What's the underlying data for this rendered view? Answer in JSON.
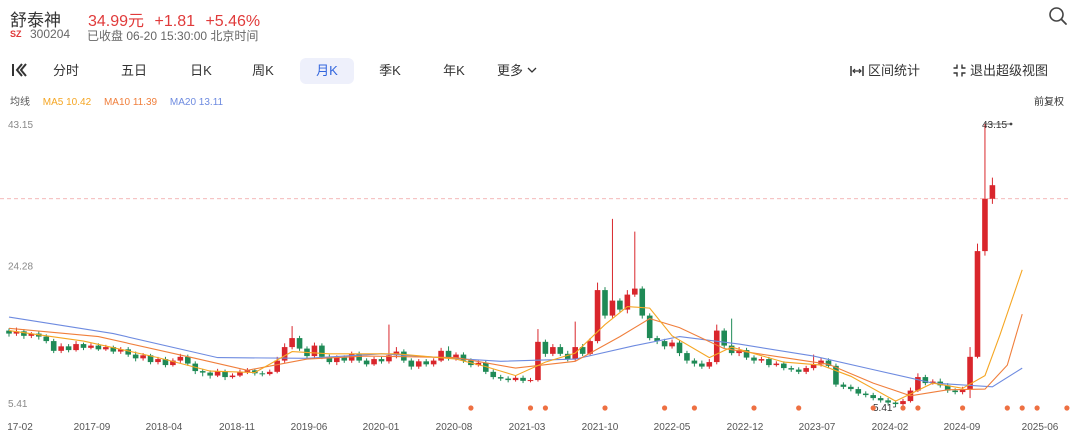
{
  "stock": {
    "name": "舒泰神",
    "price": "34.99元",
    "change": "+1.81",
    "change_pct": "+5.46%",
    "market": "SZ",
    "code": "300204",
    "status": "已收盘 06-20 15:30:00 北京时间"
  },
  "colors": {
    "up": "#d9262c",
    "down": "#1f8a56",
    "ma5": "#f5a623",
    "ma10": "#f07f3c",
    "ma20": "#6e8be0",
    "marker": "#ee7042"
  },
  "icons": {
    "search": "search-icon",
    "collapse": "collapse-icon",
    "interval": "interval-icon",
    "exit_fullscreen": "exit-fullscreen-icon",
    "chevron": "chevron-down-icon"
  },
  "toolbar": {
    "periods": [
      "分时",
      "五日",
      "日K",
      "周K",
      "月K",
      "季K",
      "年K"
    ],
    "active_period": "月K",
    "more": "更多",
    "interval_stats": "区间统计",
    "exit_super_view": "退出超级视图"
  },
  "indicators": {
    "label": "均线",
    "ma5": "MA5 10.42",
    "ma10": "MA10 11.39",
    "ma20": "MA20 13.11",
    "adjust": "前复权"
  },
  "chart_data": {
    "type": "candlestick",
    "y_ticks": [
      "43.15",
      "24.28",
      "5.41"
    ],
    "ylim": [
      5.41,
      43.15
    ],
    "x_ticks": [
      "2017-02",
      "2017-09",
      "2018-04",
      "2018-11",
      "2019-06",
      "2020-01",
      "2020-08",
      "2021-03",
      "2021-10",
      "2022-05",
      "2022-12",
      "2023-07",
      "2024-02",
      "2024-09",
      "2025-06"
    ],
    "x_tick_first_visible": "17-02",
    "max_label": "43.15",
    "min_label": "5.41",
    "reference_line": 33.18,
    "candles": [
      [
        15.6,
        15.2,
        15.9,
        14.8
      ],
      [
        15.2,
        15.5,
        16.0,
        14.9
      ],
      [
        15.5,
        14.9,
        15.8,
        14.5
      ],
      [
        14.9,
        15.2,
        15.4,
        14.6
      ],
      [
        15.2,
        14.8,
        15.6,
        14.4
      ],
      [
        14.8,
        14.2,
        15.1,
        13.9
      ],
      [
        14.2,
        12.9,
        14.5,
        12.6
      ],
      [
        12.9,
        13.5,
        13.9,
        12.6
      ],
      [
        13.5,
        13.0,
        13.8,
        12.7
      ],
      [
        13.0,
        13.8,
        14.2,
        12.8
      ],
      [
        13.8,
        13.3,
        14.0,
        13.0
      ],
      [
        13.3,
        13.6,
        13.9,
        13.1
      ],
      [
        13.6,
        13.1,
        13.9,
        12.9
      ],
      [
        13.1,
        13.4,
        13.7,
        12.9
      ],
      [
        13.4,
        12.8,
        13.6,
        12.5
      ],
      [
        12.8,
        13.1,
        13.4,
        12.5
      ],
      [
        13.1,
        12.4,
        13.4,
        12.1
      ],
      [
        12.4,
        11.9,
        12.8,
        11.5
      ],
      [
        11.9,
        12.3,
        12.6,
        11.6
      ],
      [
        12.3,
        11.4,
        12.5,
        11.1
      ],
      [
        11.4,
        11.8,
        12.1,
        11.1
      ],
      [
        11.8,
        11.0,
        12.1,
        10.7
      ],
      [
        11.0,
        11.6,
        11.9,
        10.8
      ],
      [
        11.6,
        12.1,
        12.5,
        11.3
      ],
      [
        12.1,
        11.2,
        12.4,
        10.9
      ],
      [
        11.2,
        10.2,
        11.5,
        9.8
      ],
      [
        10.2,
        10.0,
        10.5,
        9.5
      ],
      [
        10.0,
        9.6,
        10.3,
        9.2
      ],
      [
        9.6,
        10.2,
        10.5,
        9.4
      ],
      [
        10.2,
        9.4,
        10.4,
        9.0
      ],
      [
        9.4,
        9.6,
        9.9,
        9.2
      ],
      [
        9.6,
        10.1,
        10.4,
        9.4
      ],
      [
        10.1,
        10.3,
        10.6,
        9.8
      ],
      [
        10.3,
        9.9,
        10.5,
        9.6
      ],
      [
        9.9,
        9.8,
        10.2,
        9.5
      ],
      [
        9.8,
        10.1,
        10.4,
        9.6
      ],
      [
        10.1,
        11.6,
        12.1,
        9.9
      ],
      [
        11.6,
        13.4,
        13.9,
        11.3
      ],
      [
        13.4,
        14.6,
        16.2,
        13.1
      ],
      [
        14.6,
        13.2,
        14.9,
        12.9
      ],
      [
        13.2,
        12.2,
        13.5,
        11.8
      ],
      [
        12.2,
        13.6,
        14.0,
        11.9
      ],
      [
        13.6,
        12.1,
        13.9,
        11.8
      ],
      [
        12.1,
        11.4,
        12.4,
        11.1
      ],
      [
        11.4,
        12.0,
        12.3,
        11.0
      ],
      [
        12.0,
        11.6,
        12.3,
        11.3
      ],
      [
        11.6,
        12.5,
        12.8,
        11.3
      ],
      [
        12.5,
        11.6,
        12.8,
        11.3
      ],
      [
        11.6,
        11.1,
        11.9,
        10.8
      ],
      [
        11.1,
        11.8,
        12.1,
        10.9
      ],
      [
        11.8,
        11.5,
        12.1,
        11.2
      ],
      [
        11.5,
        12.3,
        16.4,
        11.2
      ],
      [
        12.3,
        12.8,
        13.4,
        11.9
      ],
      [
        12.8,
        11.6,
        13.1,
        11.3
      ],
      [
        11.6,
        10.8,
        11.9,
        10.4
      ],
      [
        10.8,
        11.5,
        11.8,
        10.5
      ],
      [
        11.5,
        11.1,
        11.8,
        10.8
      ],
      [
        11.1,
        11.6,
        11.9,
        10.8
      ],
      [
        11.6,
        12.9,
        13.3,
        11.4
      ],
      [
        12.9,
        11.9,
        13.5,
        11.6
      ],
      [
        11.9,
        12.4,
        12.7,
        11.6
      ],
      [
        12.4,
        11.6,
        12.7,
        11.3
      ],
      [
        11.6,
        11.0,
        11.9,
        10.7
      ],
      [
        11.0,
        11.3,
        11.6,
        10.8
      ],
      [
        11.3,
        10.1,
        11.6,
        9.8
      ],
      [
        10.1,
        9.4,
        10.4,
        9.1
      ],
      [
        9.4,
        9.2,
        9.7,
        8.9
      ],
      [
        9.2,
        9.0,
        9.5,
        8.7
      ],
      [
        9.0,
        9.3,
        9.6,
        8.8
      ],
      [
        9.3,
        8.9,
        9.6,
        8.6
      ],
      [
        8.9,
        9.0,
        9.3,
        8.7
      ],
      [
        9.0,
        14.1,
        15.8,
        8.8
      ],
      [
        14.1,
        12.5,
        14.4,
        12.1
      ],
      [
        12.5,
        13.4,
        13.8,
        12.2
      ],
      [
        13.4,
        12.5,
        13.8,
        12.2
      ],
      [
        12.5,
        11.8,
        12.9,
        11.5
      ],
      [
        11.8,
        13.4,
        16.8,
        11.6
      ],
      [
        13.4,
        12.5,
        13.8,
        12.2
      ],
      [
        12.5,
        14.2,
        14.6,
        12.3
      ],
      [
        14.2,
        21.0,
        22.0,
        13.9
      ],
      [
        21.0,
        17.6,
        21.4,
        17.2
      ],
      [
        17.6,
        19.6,
        30.5,
        17.3
      ],
      [
        19.6,
        18.4,
        19.9,
        18.1
      ],
      [
        18.4,
        20.4,
        21.0,
        17.9
      ],
      [
        20.4,
        21.2,
        28.8,
        20.1
      ],
      [
        21.2,
        17.6,
        21.5,
        17.2
      ],
      [
        17.6,
        14.6,
        17.9,
        14.3
      ],
      [
        14.6,
        14.2,
        14.9,
        13.8
      ],
      [
        14.2,
        13.5,
        14.5,
        13.1
      ],
      [
        13.5,
        14.0,
        14.4,
        13.2
      ],
      [
        14.0,
        12.6,
        14.3,
        12.2
      ],
      [
        12.6,
        11.6,
        12.9,
        11.2
      ],
      [
        11.6,
        11.2,
        11.9,
        10.8
      ],
      [
        11.2,
        10.8,
        11.6,
        10.5
      ],
      [
        10.8,
        11.4,
        11.8,
        10.5
      ],
      [
        11.4,
        15.6,
        16.4,
        11.1
      ],
      [
        15.6,
        13.6,
        15.9,
        13.3
      ],
      [
        13.6,
        12.6,
        17.2,
        12.3
      ],
      [
        12.6,
        13.0,
        13.4,
        12.2
      ],
      [
        13.0,
        12.0,
        13.3,
        11.7
      ],
      [
        12.0,
        11.6,
        12.3,
        11.2
      ],
      [
        11.6,
        11.8,
        12.1,
        11.3
      ],
      [
        11.8,
        11.0,
        12.1,
        10.7
      ],
      [
        11.0,
        11.2,
        11.5,
        10.8
      ],
      [
        11.2,
        10.6,
        11.5,
        10.3
      ],
      [
        10.6,
        10.4,
        10.9,
        10.1
      ],
      [
        10.4,
        10.1,
        10.7,
        9.8
      ],
      [
        10.1,
        10.6,
        10.9,
        9.8
      ],
      [
        10.6,
        11.1,
        12.4,
        10.3
      ],
      [
        11.1,
        11.6,
        12.0,
        10.8
      ],
      [
        11.6,
        10.9,
        11.9,
        10.6
      ],
      [
        10.9,
        8.4,
        11.2,
        8.1
      ],
      [
        8.4,
        8.1,
        8.7,
        7.8
      ],
      [
        8.1,
        7.8,
        8.4,
        7.5
      ],
      [
        7.8,
        7.2,
        8.1,
        6.9
      ],
      [
        7.2,
        7.0,
        7.5,
        6.7
      ],
      [
        7.0,
        6.6,
        7.3,
        6.3
      ],
      [
        6.6,
        6.3,
        6.9,
        6.0
      ],
      [
        6.3,
        6.0,
        6.6,
        5.7
      ],
      [
        6.0,
        5.8,
        6.3,
        5.41
      ],
      [
        5.8,
        6.2,
        6.5,
        5.6
      ],
      [
        6.2,
        7.6,
        8.0,
        6.0
      ],
      [
        7.6,
        9.4,
        9.9,
        7.4
      ],
      [
        9.4,
        8.6,
        9.7,
        8.3
      ],
      [
        8.6,
        8.8,
        9.1,
        8.4
      ],
      [
        8.8,
        8.3,
        9.2,
        8.0
      ],
      [
        8.3,
        7.6,
        8.6,
        7.3
      ],
      [
        7.6,
        7.4,
        7.9,
        7.1
      ],
      [
        7.4,
        7.8,
        8.1,
        7.1
      ],
      [
        7.8,
        12.1,
        13.4,
        6.6
      ],
      [
        12.1,
        26.2,
        27.2,
        11.9
      ],
      [
        26.2,
        33.18,
        43.15,
        25.6
      ],
      [
        33.18,
        34.99,
        36.0,
        32.5
      ]
    ],
    "ma5": [
      [
        0,
        15.6
      ],
      [
        10,
        14.2
      ],
      [
        20,
        12.0
      ],
      [
        27,
        10.2
      ],
      [
        33,
        10.0
      ],
      [
        38,
        12.8
      ],
      [
        43,
        12.5
      ],
      [
        52,
        12.5
      ],
      [
        60,
        11.8
      ],
      [
        64,
        10.8
      ],
      [
        68,
        9.6
      ],
      [
        72,
        11.4
      ],
      [
        76,
        12.6
      ],
      [
        80,
        16.4
      ],
      [
        83,
        18.8
      ],
      [
        86,
        18.6
      ],
      [
        89,
        14.9
      ],
      [
        94,
        12.0
      ],
      [
        97,
        13.4
      ],
      [
        104,
        11.4
      ],
      [
        109,
        11.0
      ],
      [
        113,
        9.5
      ],
      [
        119,
        6.2
      ],
      [
        124,
        8.6
      ],
      [
        128,
        7.9
      ],
      [
        131,
        9.6
      ],
      [
        133,
        15.0
      ],
      [
        136,
        23.7
      ]
    ],
    "ma10": [
      [
        0,
        15.9
      ],
      [
        12,
        14.8
      ],
      [
        25,
        11.9
      ],
      [
        32,
        10.3
      ],
      [
        40,
        11.8
      ],
      [
        48,
        12.2
      ],
      [
        60,
        12.0
      ],
      [
        68,
        10.6
      ],
      [
        76,
        11.5
      ],
      [
        82,
        14.8
      ],
      [
        86,
        17.2
      ],
      [
        90,
        16.0
      ],
      [
        96,
        13.2
      ],
      [
        104,
        12.0
      ],
      [
        110,
        11.1
      ],
      [
        116,
        8.6
      ],
      [
        121,
        6.9
      ],
      [
        126,
        7.7
      ],
      [
        131,
        7.8
      ],
      [
        134,
        11.0
      ],
      [
        136,
        17.8
      ]
    ],
    "ma20": [
      [
        0,
        17.4
      ],
      [
        14,
        15.2
      ],
      [
        28,
        12.0
      ],
      [
        40,
        11.9
      ],
      [
        50,
        12.5
      ],
      [
        66,
        11.5
      ],
      [
        76,
        11.8
      ],
      [
        84,
        13.6
      ],
      [
        90,
        14.8
      ],
      [
        98,
        13.8
      ],
      [
        108,
        12.2
      ],
      [
        116,
        10.4
      ],
      [
        124,
        8.6
      ],
      [
        132,
        8.1
      ],
      [
        136,
        10.6
      ]
    ],
    "event_markers": [
      31,
      35,
      36,
      40,
      44,
      46,
      50,
      53,
      58,
      60,
      61,
      64,
      67,
      68,
      69,
      71
    ]
  }
}
